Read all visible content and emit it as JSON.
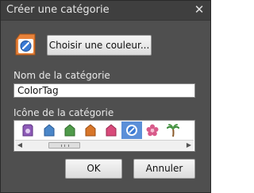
{
  "dialog": {
    "title": "Créer une catégorie",
    "close_icon": "close-icon"
  },
  "tag_preview": {
    "icon": "color-tag-icon",
    "color": "#3a7ad4"
  },
  "choose_color_button": "Choisir une couleur...",
  "name_field": {
    "label": "Nom de la catégorie",
    "value": "ColorTag"
  },
  "icon_picker": {
    "label": "Icône de la catégorie",
    "icons": [
      {
        "name": "purple-badge-icon",
        "color": "#8e5bb8"
      },
      {
        "name": "blue-tag-icon",
        "color": "#4a86c8"
      },
      {
        "name": "green-tag-icon",
        "color": "#4f9a4a"
      },
      {
        "name": "orange-tag-icon",
        "color": "#d8762a"
      },
      {
        "name": "pink-tag-icon",
        "color": "#d84a7a"
      },
      {
        "name": "color-tag-icon",
        "color": "#3a7ad4",
        "selected": true
      },
      {
        "name": "flower-icon",
        "color": "#d85a8a"
      },
      {
        "name": "palm-tree-icon",
        "color": "#3a8a3a"
      }
    ]
  },
  "buttons": {
    "ok": "OK",
    "cancel": "Annuler"
  }
}
